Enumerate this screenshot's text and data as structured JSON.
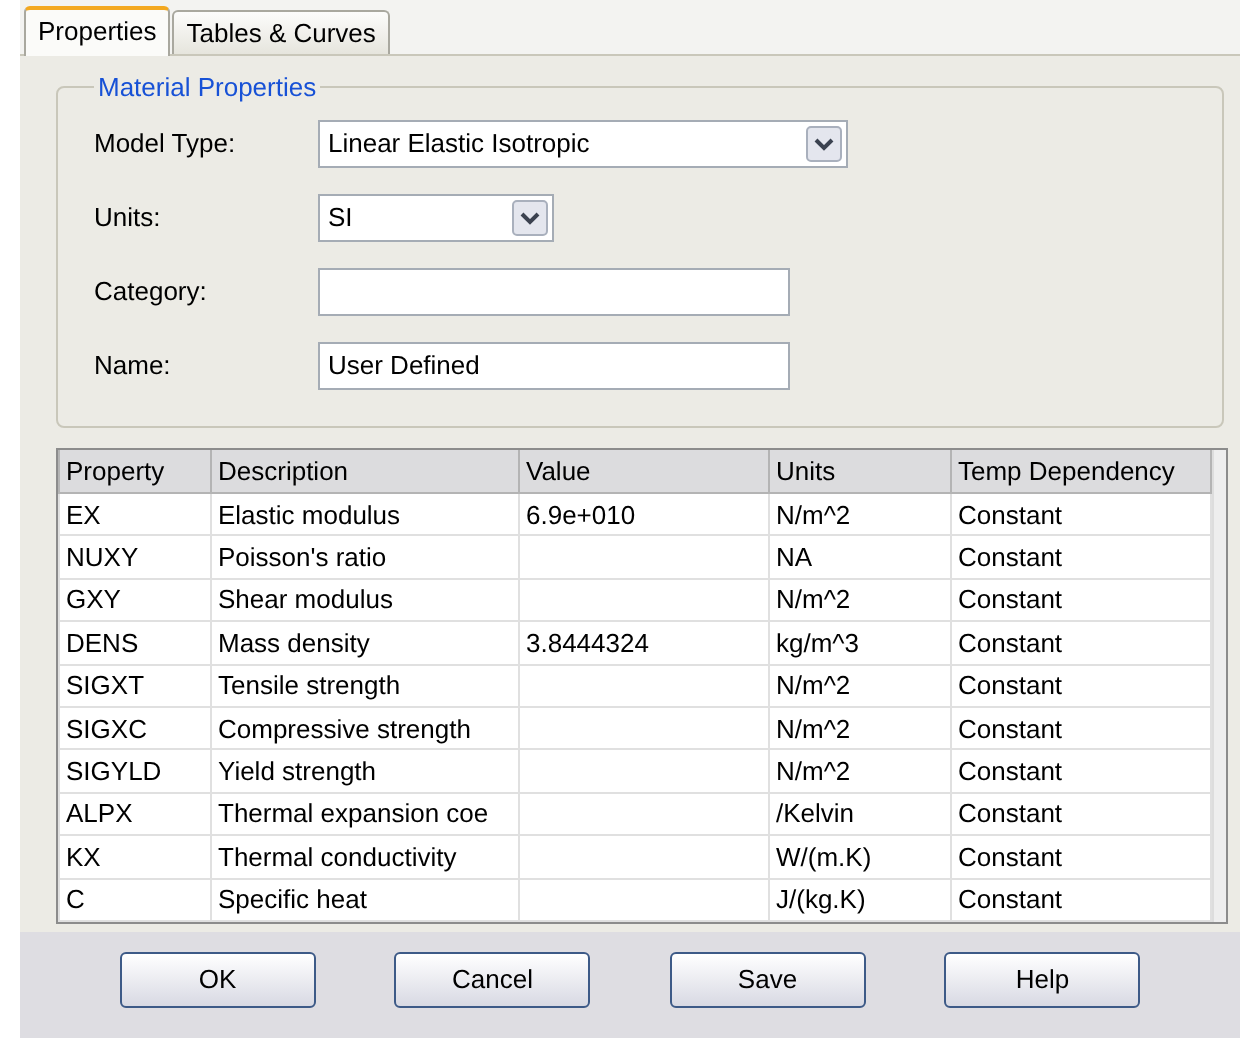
{
  "tabs": [
    {
      "label": "Properties",
      "selected": true
    },
    {
      "label": "Tables & Curves",
      "selected": false
    }
  ],
  "material_properties": {
    "title": "Material Properties",
    "fields": [
      {
        "label": "Model Type:",
        "kind": "dropdown",
        "value": "Linear Elastic Isotropic"
      },
      {
        "label": "Units:",
        "kind": "dropdown",
        "value": "SI"
      },
      {
        "label": "Category:",
        "kind": "text"
      },
      {
        "label": "Name:",
        "kind": "text",
        "value": "User Defined"
      }
    ]
  },
  "table": {
    "columns": [
      "Property",
      "Description",
      "Value",
      "Units",
      "Temp Dependency"
    ],
    "rows": [
      [
        "EX",
        "Elastic modulus",
        "6.9e+010",
        "N/m^2",
        "Constant"
      ],
      [
        "NUXY",
        "Poisson's ratio",
        "",
        "NA",
        "Constant"
      ],
      [
        "GXY",
        "Shear modulus",
        "",
        "N/m^2",
        "Constant"
      ],
      [
        "DENS",
        "Mass density",
        "3.8444324",
        "kg/m^3",
        "Constant"
      ],
      [
        "SIGXT",
        "Tensile strength",
        "",
        "N/m^2",
        "Constant"
      ],
      [
        "SIGXC",
        "Compressive strength",
        "",
        "N/m^2",
        "Constant"
      ],
      [
        "SIGYLD",
        "Yield strength",
        "",
        "N/m^2",
        "Constant"
      ],
      [
        "ALPX",
        "Thermal expansion coe",
        "",
        "/Kelvin",
        "Constant"
      ],
      [
        "KX",
        "Thermal conductivity",
        "",
        "W/(m.K)",
        "Constant"
      ],
      [
        "C",
        "Specific heat",
        "",
        "J/(kg.K)",
        "Constant"
      ]
    ]
  },
  "buttons": [
    "OK",
    "Cancel",
    "Save",
    "Help"
  ]
}
